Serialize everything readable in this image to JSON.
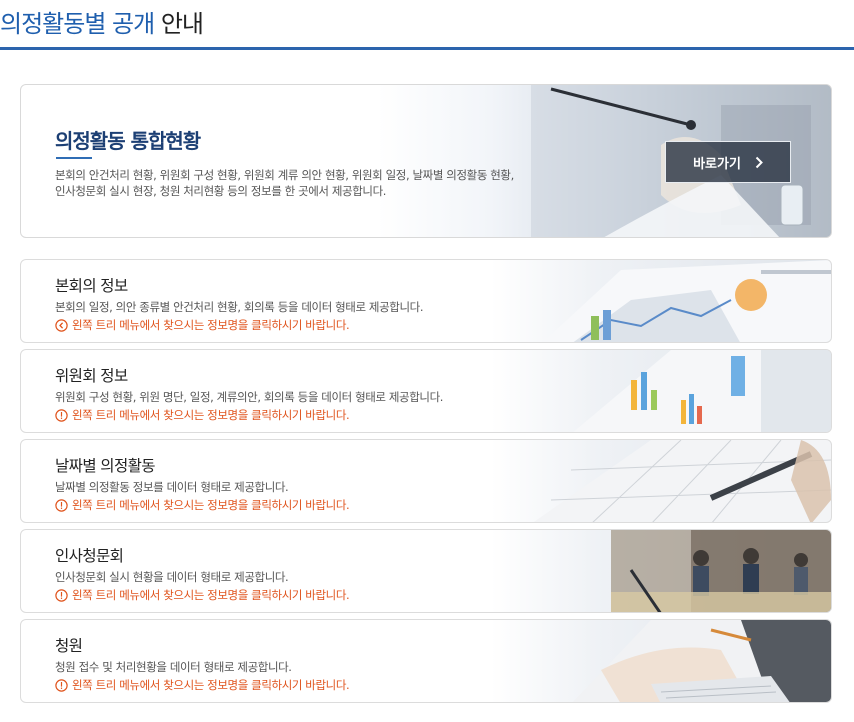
{
  "page": {
    "title_accent": "의정활동별 공개",
    "title_rest": "안내"
  },
  "featured": {
    "title": "의정활동 통합현황",
    "desc_line1": "본회의 안건처리 현황, 위원회 구성 현황, 위원회 계류 의안 현황, 위원회 일정, 날짜별 의정활동 현황,",
    "desc_line2": "인사청문회 실시 현장, 청원 처리현황 등의 정보를 한 곳에서 제공합니다.",
    "button_label": "바로가기",
    "button_icon": "chevron-right-icon"
  },
  "cards": [
    {
      "title": "본회의 정보",
      "desc": "본회의 일정, 의안 종류별 안건처리 현황, 회의록 등을 데이터 형태로 제공합니다.",
      "note": "왼쪽 트리 메뉴에서 찾으시는 정보명을 클릭하시기 바랍니다.",
      "note_icon": "arrow-left-circle-icon",
      "photo": "charts-on-paper"
    },
    {
      "title": "위원회 정보",
      "desc": "위원회 구성 현황, 위원 명단, 일정, 계류의안, 회의록 등을 데이터 형태로 제공합니다.",
      "note": "왼쪽 트리 메뉴에서 찾으시는 정보명을 클릭하시기 바랍니다.",
      "note_icon": "exclamation-circle-icon",
      "photo": "bar-chart-report"
    },
    {
      "title": "날짜별 의정활동",
      "desc": "날짜별 의정활동 정보를 데이터 형태로 제공합니다.",
      "note": "왼쪽 트리 메뉴에서 찾으시는 정보명을 클릭하시기 바랍니다.",
      "note_icon": "exclamation-circle-icon",
      "photo": "calendar-with-pen"
    },
    {
      "title": "인사청문회",
      "desc": "인사청문회 실시 현황을 데이터 형태로 제공합니다.",
      "note": "왼쪽 트리 메뉴에서 찾으시는 정보명을 클릭하시기 바랍니다.",
      "note_icon": "exclamation-circle-icon",
      "photo": "hearing-room"
    },
    {
      "title": "청원",
      "desc": "청원 접수 및 처리현황을 데이터 형태로 제공합니다.",
      "note": "왼쪽 트리 메뉴에서 찾으시는 정보명을 클릭하시기 바랍니다.",
      "note_icon": "exclamation-circle-icon",
      "photo": "typing-on-laptop"
    }
  ],
  "colors": {
    "accent": "#1f5fae",
    "rule": "#2c64ad",
    "featured_title": "#1c3f74",
    "note": "#e0541d"
  }
}
